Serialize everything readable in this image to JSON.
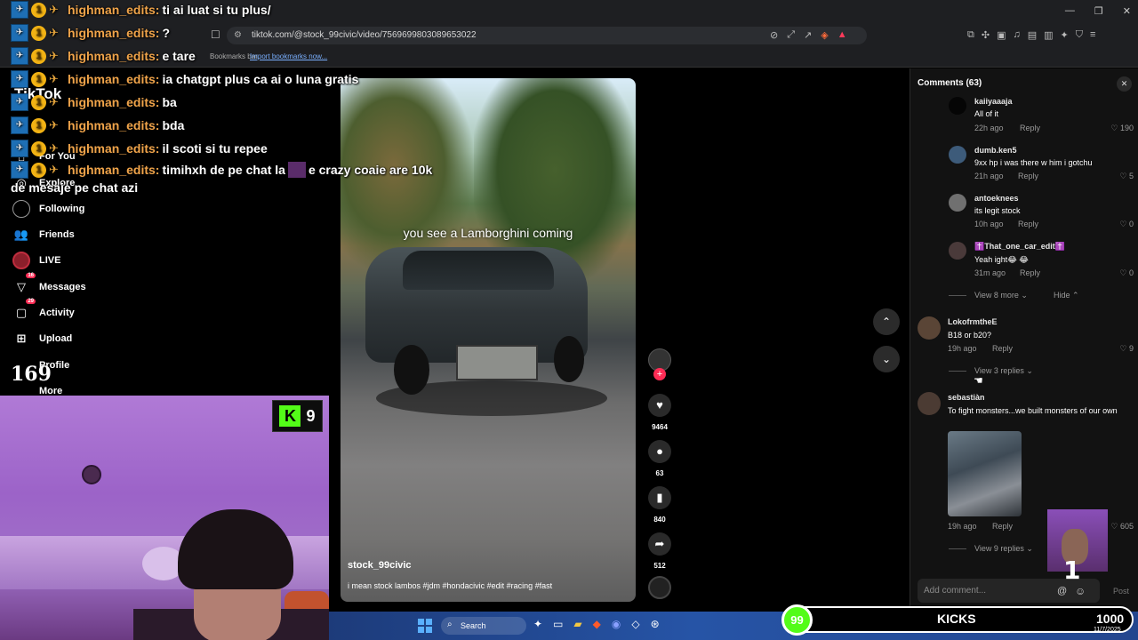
{
  "browser": {
    "url": "tiktok.com/@stock_99civic/video/7569699803089653022",
    "bookmarks_hint": "Bookmarks bar.",
    "import_bookmarks": "Import bookmarks now..."
  },
  "tiktok_nav": {
    "logo": "TikTok",
    "items": [
      {
        "label": "For You",
        "icon": "home-icon"
      },
      {
        "label": "Explore",
        "icon": "compass-icon"
      },
      {
        "label": "Following",
        "icon": "ring-icon"
      },
      {
        "label": "Friends",
        "icon": "friends-icon"
      },
      {
        "label": "LIVE",
        "icon": "live-icon"
      },
      {
        "label": "Messages",
        "icon": "message-icon",
        "badge": "16"
      },
      {
        "label": "Activity",
        "icon": "activity-icon",
        "badge": "29"
      },
      {
        "label": "Upload",
        "icon": "upload-icon"
      },
      {
        "label": "Profile",
        "icon": "profile-icon"
      },
      {
        "label": "More",
        "icon": "more-icon"
      }
    ]
  },
  "video": {
    "overlay_text": "you see a Lamborghini coming",
    "author": "stock_99civic",
    "description": "i mean stock lambos #jdm #hondacivic #edit #racing #fast"
  },
  "actions": {
    "likes": "9464",
    "comments": "63",
    "saves": "840",
    "shares": "512"
  },
  "comments": {
    "title": "Comments (63)",
    "add_placeholder": "Add comment...",
    "post_label": "Post",
    "reply_label": "Reply",
    "items": [
      {
        "user": "kaiiyaaaja",
        "text": "All of it",
        "time": "22h ago",
        "likes": "190"
      },
      {
        "user": "dumb.ken5",
        "text": "9xx hp i was there w him i gotchu",
        "time": "21h ago",
        "likes": "5"
      },
      {
        "user": "antoeknees",
        "text": "its legit stock",
        "time": "10h ago",
        "likes": "0"
      },
      {
        "user": "✝️That_one_car_edit✝️",
        "text": "Yeah ight😂 😂",
        "time": "31m ago",
        "likes": "0"
      },
      {
        "user": "LokofrmtheE",
        "text": "B18 or b20?",
        "time": "19h ago",
        "likes": "9"
      },
      {
        "user": "sebastiàn",
        "text": "To fight monsters...we built monsters of our own",
        "time": "19h ago",
        "likes": "605"
      }
    ],
    "view_more_1": "View 8 more",
    "hide": "Hide",
    "view_replies_1": "View 3 replies",
    "view_replies_2": "View 9 replies"
  },
  "chat": {
    "lines": [
      {
        "user": "highman_edits:",
        "msg": "ti ai luat si tu plus/"
      },
      {
        "user": "highman_edits:",
        "msg": "?"
      },
      {
        "user": "highman_edits:",
        "msg": "e tare"
      },
      {
        "user": "highman_edits:",
        "msg": "ia chatgpt plus ca ai o luna gratis"
      },
      {
        "user": "highman_edits:",
        "msg": "ba"
      },
      {
        "user": "highman_edits:",
        "msg": "bda"
      },
      {
        "user": "highman_edits:",
        "msg": "il scoti si tu repee"
      },
      {
        "user": "highman_edits:",
        "msg": "timihxh de pe chat la"
      }
    ],
    "last_msg_cont": "e crazy coaie are 10k",
    "last_msg_wrap": "de mesaje pe chat azi",
    "badge_level": "1"
  },
  "stream": {
    "viewer_count": "169",
    "kick_count": "9",
    "kicks_circle": "99",
    "kicks_label": "KICKS",
    "kicks_goal": "1000",
    "mini_badge": "1"
  },
  "taskbar": {
    "search": "Search",
    "date": "11/7/2025"
  }
}
